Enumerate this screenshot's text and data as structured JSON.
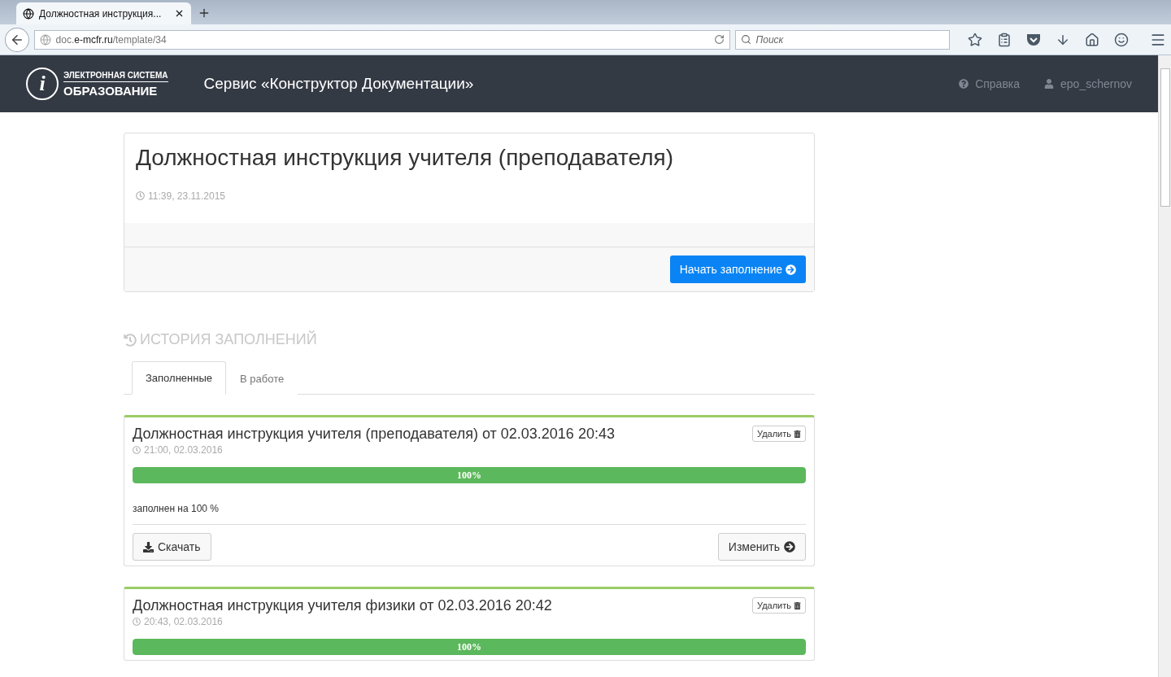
{
  "browser": {
    "tab_title": "Должностная инструкция...",
    "url_prefix": "doc.",
    "url_domain": "e-mcfr.ru",
    "url_path": "/template/34",
    "search_placeholder": "Поиск"
  },
  "header": {
    "logo_mark": "i",
    "logo_top": "ЭЛЕКТРОННАЯ СИСТЕМА",
    "logo_bottom": "ОБРАЗОВАНИЕ",
    "service_title": "Сервис «Конструктор Документации»",
    "help": "Справка",
    "user": "epo_schernov"
  },
  "template": {
    "title": "Должностная инструкция учителя (преподавателя)",
    "time": "11:39, 23.11.2015",
    "start_button": "Начать заполнение"
  },
  "history": {
    "heading": "ИСТОРИЯ ЗАПОЛНЕНИЙ",
    "tabs": [
      {
        "label": "Заполненные",
        "selected": true
      },
      {
        "label": "В работе",
        "selected": false
      }
    ],
    "entries": [
      {
        "title": "Должностная инструкция учителя (преподавателя) от 02.03.2016 20:43",
        "time": "21:00, 02.03.2016",
        "delete": "Удалить",
        "level": 1,
        "progress_label": "100%",
        "status": "заполнен на 100 %",
        "download": "Скачать",
        "edit": "Изменить"
      },
      {
        "title": "Должностная инструкция учителя физики от 02.03.2016 20:42",
        "time": "20:43, 02.03.2016",
        "delete": "Удалить",
        "level": 1,
        "progress_label": "100%"
      }
    ]
  }
}
